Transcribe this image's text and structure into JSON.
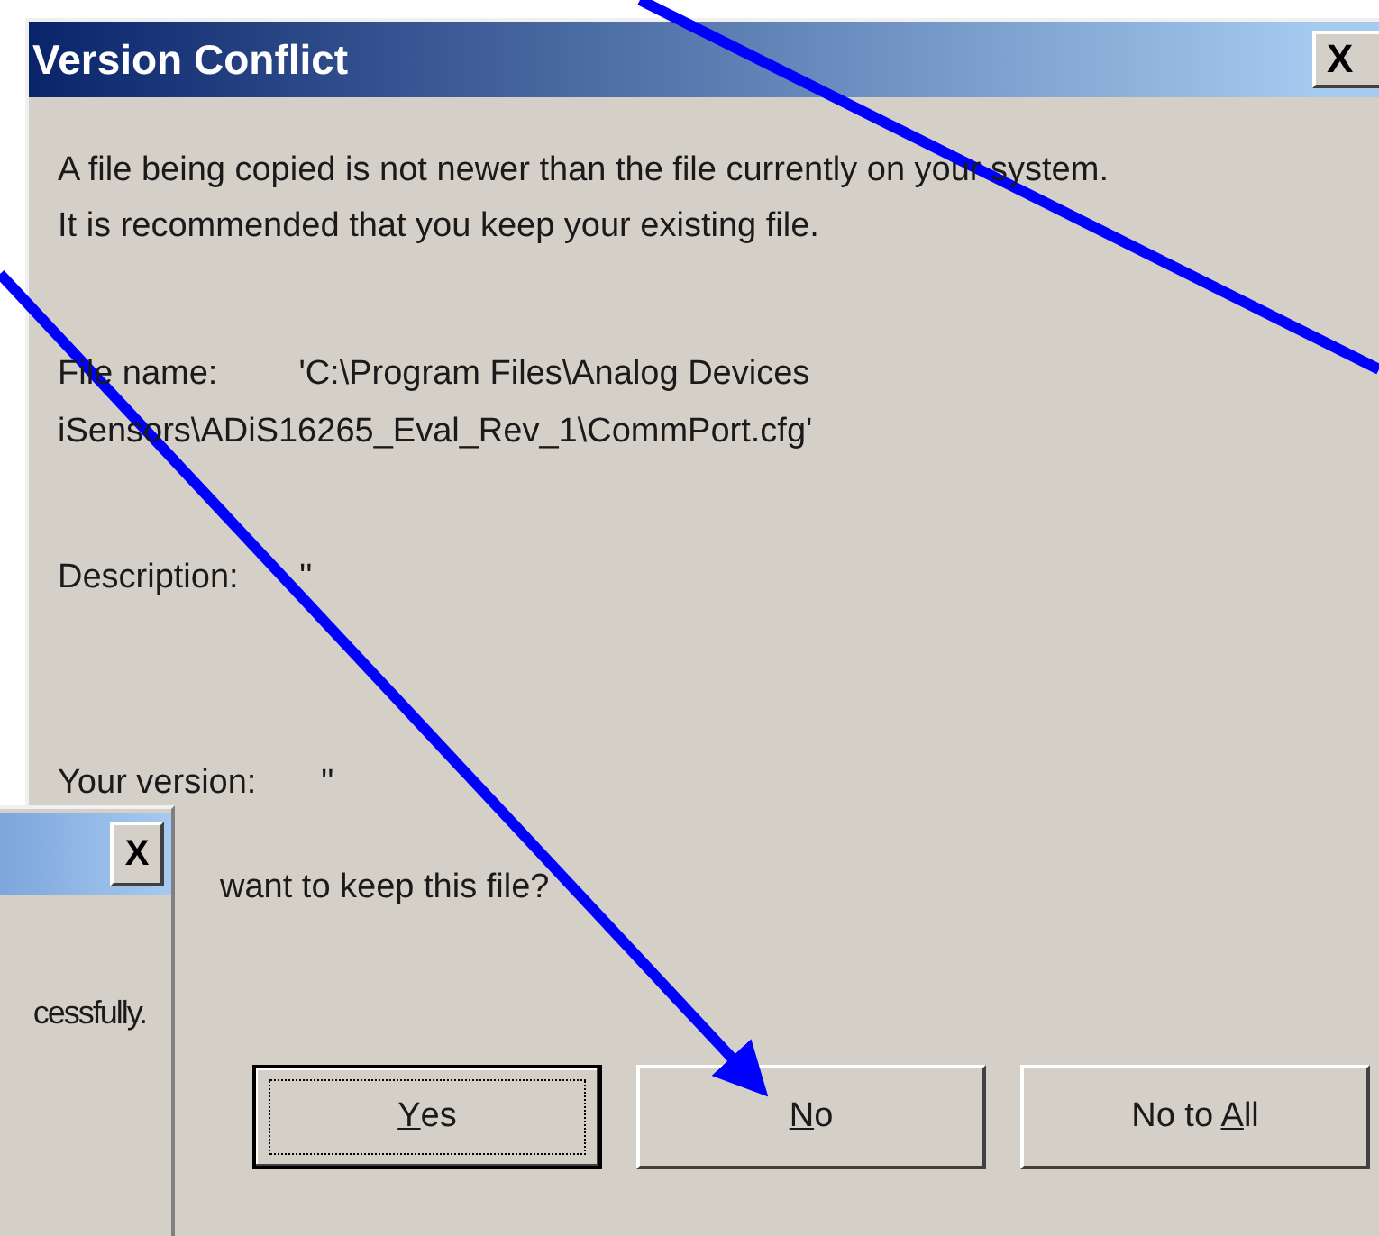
{
  "window": {
    "title": "Version Conflict",
    "close": "X"
  },
  "message": [
    "A file being copied is not newer than the file currently on your system.",
    "It is recommended that you keep your existing file."
  ],
  "file_name": {
    "label": "File name:",
    "value_lines": [
      "'C:\\Program Files\\Analog Devices",
      "iSensors\\ADiS16265_Eval_Rev_1\\CommPort.cfg'"
    ]
  },
  "description": {
    "label": "Description:",
    "value": "''"
  },
  "your_version": {
    "label": "Your version:",
    "value": "''"
  },
  "question": "want to keep this file?",
  "buttons": [
    {
      "key": "Y",
      "after": "es",
      "default": true
    },
    {
      "key": "N",
      "after": "o",
      "default": false
    },
    {
      "before": "No to ",
      "key": "A",
      "after": "ll",
      "default": false
    }
  ],
  "background_dialog": {
    "close": "X",
    "message": "cessfully."
  }
}
